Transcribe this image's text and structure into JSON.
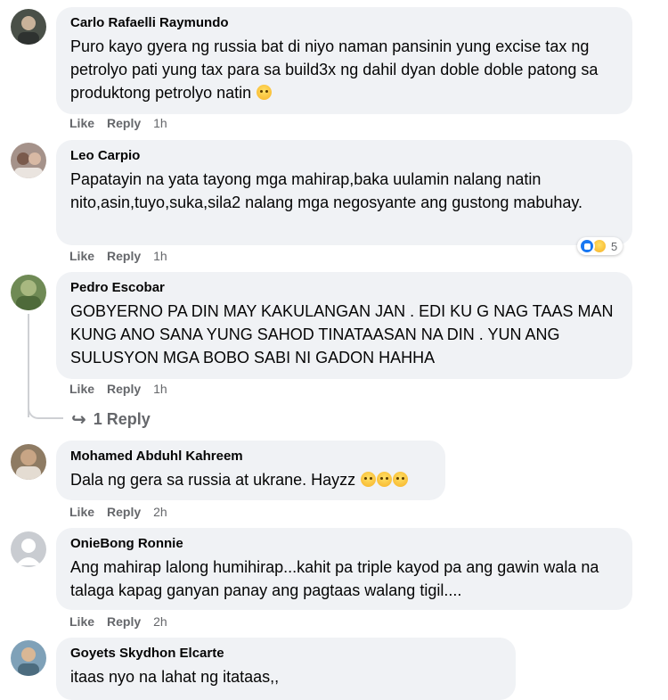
{
  "comments": [
    {
      "author": "Carlo Rafaelli Raymundo",
      "text": "Puro kayo gyera ng russia bat di niyo naman pansinin yung excise tax ng petrolyo pati yung tax para sa build3x ng dahil dyan doble doble patong sa produktong petrolyo natin",
      "like": "Like",
      "reply": "Reply",
      "time": "1h",
      "avatar_color": "#4a5048",
      "emojis": 1
    },
    {
      "author": "Leo Carpio",
      "text": "Papatayin na yata tayong mga mahirap,baka uulamin nalang natin nito,asin,tuyo,suka,sila2 nalang mga negosyante ang gustong mabuhay.",
      "like": "Like",
      "reply": "Reply",
      "time": "1h",
      "avatar_color": "#a5928a",
      "reaction_count": "5"
    },
    {
      "author": "Pedro Escobar",
      "text": "GOBYERNO PA DIN MAY KAKULANGAN JAN . EDI KU G NAG TAAS MAN KUNG ANO SANA YUNG SAHOD TINATAASAN NA DIN . YUN ANG SULUSYON MGA BOBO SABI NI GADON HAHHA",
      "like": "Like",
      "reply": "Reply",
      "time": "1h",
      "avatar_color": "#6f8a55",
      "replies_link": "1 Reply"
    },
    {
      "author": "Mohamed Abduhl Kahreem",
      "text": "Dala ng gera sa russia at ukrane. Hayzz",
      "like": "Like",
      "reply": "Reply",
      "time": "2h",
      "avatar_color": "#8e7b63",
      "emojis": 3
    },
    {
      "author": "OnieBong Ronnie",
      "text": "Ang mahirap lalong humihirap...kahit pa triple kayod pa ang gawin wala na talaga kapag ganyan panay ang pagtaas walang tigil....",
      "like": "Like",
      "reply": "Reply",
      "time": "2h",
      "avatar_color": "#c9ccd1"
    },
    {
      "author": "Goyets Skydhon Elcarte",
      "text": "itaas nyo na lahat ng itataas,,",
      "avatar_color": "#7fa1b8"
    }
  ],
  "colors": {
    "bubble": "#f0f2f5",
    "meta_text": "#65676b",
    "like_blue": "#1877f2"
  }
}
